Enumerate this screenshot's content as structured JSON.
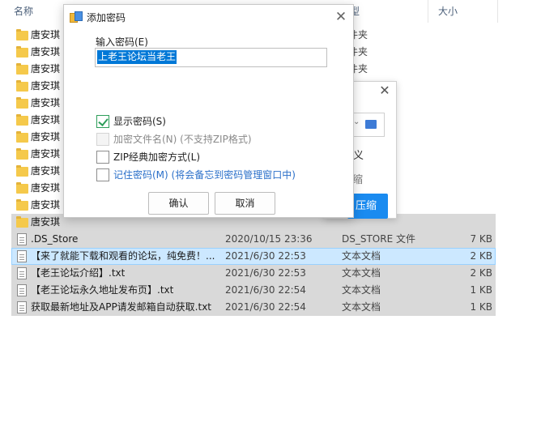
{
  "explorer": {
    "columns": {
      "name": "名称",
      "type_fragment": "型",
      "size": "大小"
    },
    "folders": [
      {
        "name": "唐安琪",
        "type_fragment": "件夹"
      },
      {
        "name": "唐安琪",
        "type_fragment": "件夹"
      },
      {
        "name": "唐安琪",
        "type_fragment": "件夹"
      },
      {
        "name": "唐安琪",
        "type_fragment": ""
      },
      {
        "name": "唐安琪",
        "type_fragment": ""
      },
      {
        "name": "唐安琪",
        "type_fragment": ""
      },
      {
        "name": "唐安琪",
        "type_fragment": ""
      },
      {
        "name": "唐安琪",
        "type_fragment": ""
      },
      {
        "name": "唐安琪",
        "type_fragment": ""
      },
      {
        "name": "唐安琪",
        "type_fragment": ""
      },
      {
        "name": "唐安琪",
        "type_fragment": ""
      },
      {
        "name": "唐安琪",
        "type_fragment": ""
      }
    ],
    "files": [
      {
        "name": ".DS_Store",
        "date": "2020/10/15 23:36",
        "type": "DS_STORE 文件",
        "size": "7 KB"
      },
      {
        "name": "【来了就能下载和观看的论坛，纯免费！...",
        "date": "2021/6/30 22:53",
        "type": "文本文档",
        "size": "2 KB"
      },
      {
        "name": "【老王论坛介绍】.txt",
        "date": "2021/6/30 22:53",
        "type": "文本文档",
        "size": "2 KB"
      },
      {
        "name": "【老王论坛永久地址发布页】.txt",
        "date": "2021/6/30 22:54",
        "type": "文本文档",
        "size": "1 KB"
      },
      {
        "name": "获取最新地址及APP请发邮箱自动获取.txt",
        "date": "2021/6/30 22:54",
        "type": "文本文档",
        "size": "1 KB"
      }
    ]
  },
  "bg_dialog": {
    "text1": "义",
    "text2": "缩",
    "compress_button": "压缩"
  },
  "password_dialog": {
    "title": "添加密码",
    "input_label": "输入密码(E)",
    "input_value": "上老王论坛当老王",
    "options": [
      {
        "label": "显示密码(S)",
        "checked": true,
        "disabled": false,
        "style": "dark"
      },
      {
        "label": "加密文件名(N) (不支持ZIP格式)",
        "checked": false,
        "disabled": true,
        "style": "gray"
      },
      {
        "label": "ZIP经典加密方式(L)",
        "checked": false,
        "disabled": false,
        "style": "dark"
      },
      {
        "label": "记住密码(M) (将会备忘到密码管理窗口中)",
        "checked": false,
        "disabled": false,
        "style": "blue"
      }
    ],
    "ok_button": "确认",
    "cancel_button": "取消"
  },
  "colors": {
    "accent": "#0078d7",
    "compress_button": "#1a8bf0",
    "check_green": "#2e9e5a",
    "link_blue": "#2a6fc9",
    "selected_row": "#cce8ff",
    "gray_row": "#d9d9d9"
  }
}
